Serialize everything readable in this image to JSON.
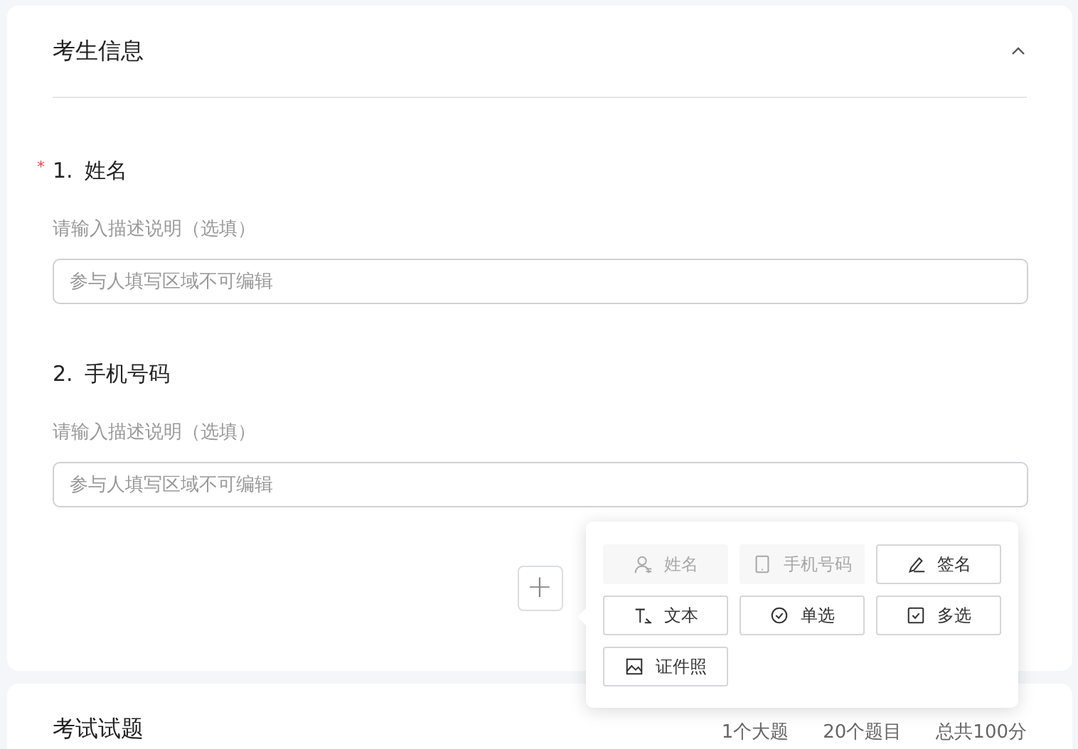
{
  "info_section": {
    "title": "考生信息",
    "expanded": true,
    "required_mark": "*",
    "questions": [
      {
        "number": "1.",
        "label": "姓名",
        "required": true,
        "description_placeholder": "请输入描述说明（选填）",
        "answer_placeholder": "参与人填写区域不可编辑"
      },
      {
        "number": "2.",
        "label": "手机号码",
        "required": false,
        "description_placeholder": "请输入描述说明（选填）",
        "answer_placeholder": "参与人填写区域不可编辑"
      }
    ],
    "add_button": "+",
    "field_menu": [
      {
        "kind": "user",
        "label": "姓名",
        "disabled": true
      },
      {
        "kind": "phone",
        "label": "手机号码",
        "disabled": true
      },
      {
        "kind": "pen",
        "label": "签名",
        "disabled": false
      },
      {
        "kind": "text",
        "label": "文本",
        "disabled": false
      },
      {
        "kind": "radio",
        "label": "单选",
        "disabled": false
      },
      {
        "kind": "checkbox",
        "label": "多选",
        "disabled": false
      },
      {
        "kind": "image",
        "label": "证件照",
        "disabled": false
      }
    ]
  },
  "exam_section": {
    "title": "考试试题",
    "stats": [
      "1个大题",
      "20个题目",
      "总共100分"
    ]
  }
}
